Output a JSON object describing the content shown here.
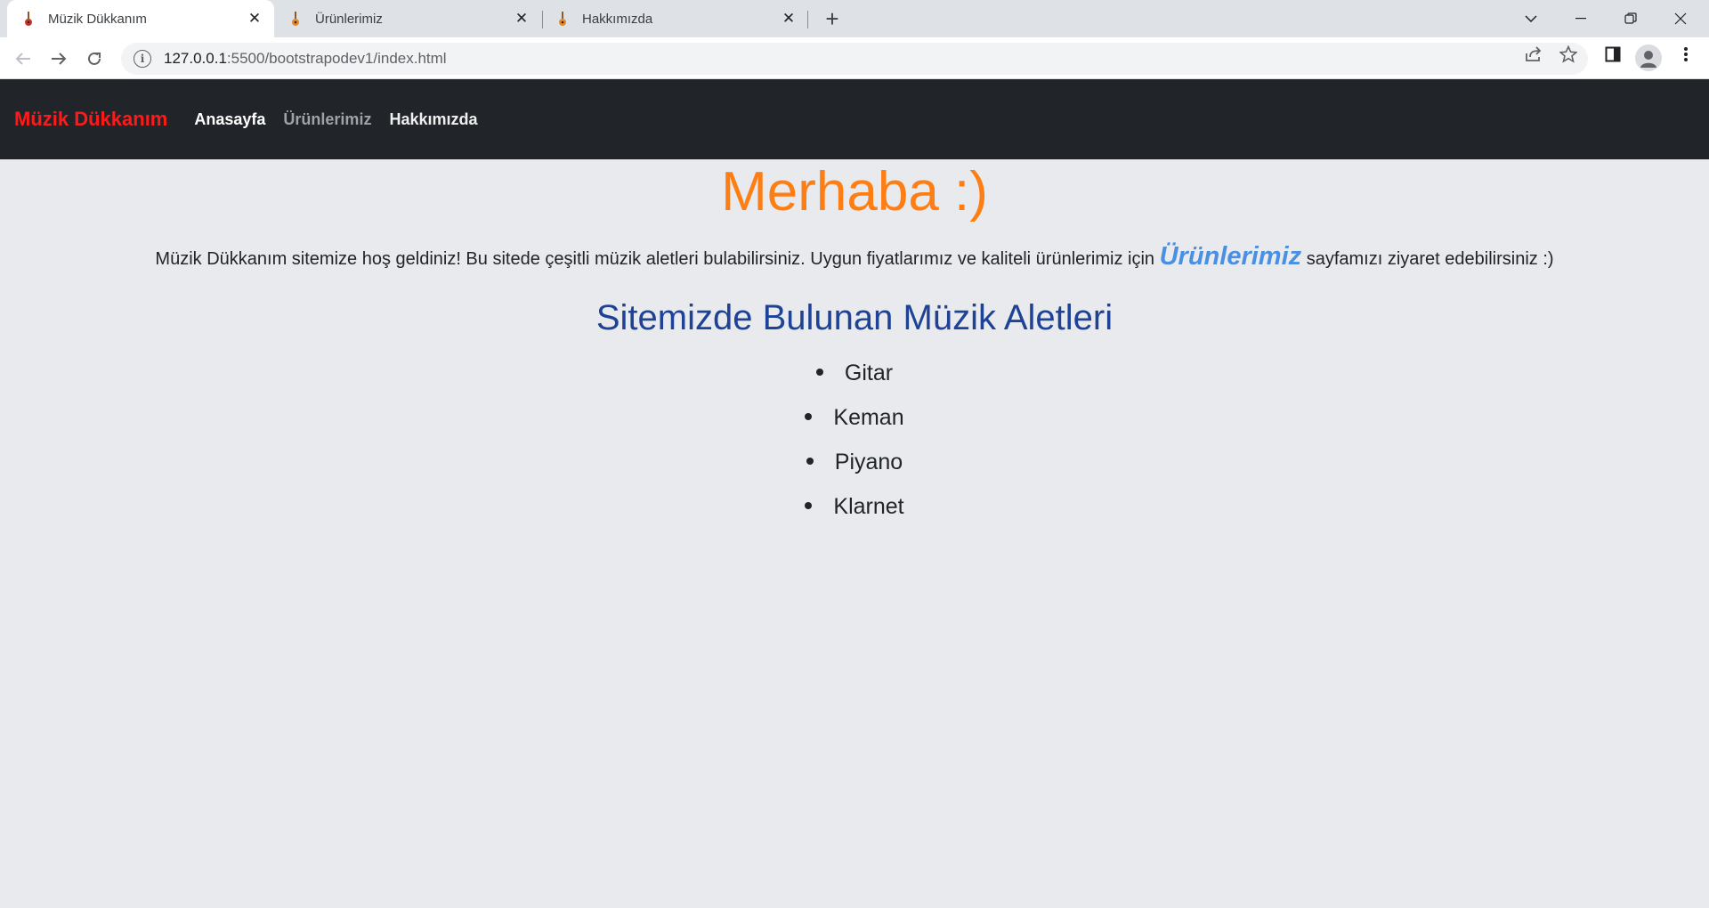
{
  "browser": {
    "tabs": [
      {
        "title": "Müzik Dükkanım",
        "active": true
      },
      {
        "title": "Ürünlerimiz",
        "active": false
      },
      {
        "title": "Hakkımızda",
        "active": false
      }
    ],
    "url_host": "127.0.0.1",
    "url_rest": ":5500/bootstrapodev1/index.html"
  },
  "navbar": {
    "brand": "Müzik Dükkanım",
    "links": [
      {
        "label": "Anasayfa",
        "state": "active"
      },
      {
        "label": "Ürünlerimiz",
        "state": "muted"
      },
      {
        "label": "Hakkımızda",
        "state": "normal"
      }
    ]
  },
  "main": {
    "hero": "Merhaba :)",
    "intro_before": "Müzik Dükkanım sitemize hoş geldiniz! Bu sitede çeşitli müzik aletleri bulabilirsiniz. Uygun fiyatlarımız ve kaliteli ürünlerimiz için ",
    "intro_link": "Ürünlerimiz",
    "intro_after": " sayfamızı ziyaret edebilirsiniz :)",
    "section_title": "Sitemizde Bulunan Müzik Aletleri",
    "instruments": [
      "Gitar",
      "Keman",
      "Piyano",
      "Klarnet"
    ]
  },
  "colors": {
    "brand": "#ff1a1a",
    "hero": "#fd7e14",
    "section_title": "#1e4296",
    "link": "#4a90e2",
    "navbar_bg": "#212529",
    "page_bg": "#e8eaed"
  }
}
